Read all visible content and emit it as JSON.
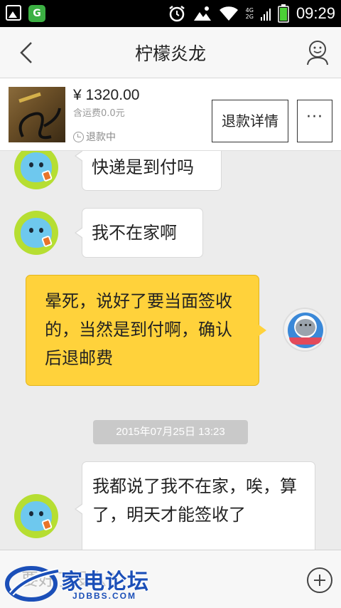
{
  "status_bar": {
    "time": "09:29",
    "network_top": "4G",
    "network_bottom": "2G"
  },
  "header": {
    "title": "柠檬炎龙"
  },
  "product": {
    "price": "¥ 1320.00",
    "shipping": "含运费0.0元",
    "status": "退款中",
    "refund_button": "退款详情",
    "more_button": "···"
  },
  "messages": [
    {
      "side": "left",
      "text": "快递是到付吗"
    },
    {
      "side": "left",
      "text": "我不在家啊"
    },
    {
      "side": "right",
      "text": "晕死，说好了要当面签收的，当然是到付啊，确认后退邮费"
    },
    {
      "side": "left",
      "text": "我都说了我不在家，唉，算了，明天才能签收了"
    }
  ],
  "timestamp": "2015年07月25日 13:23",
  "input": {
    "value": "要好了没么？"
  },
  "watermark": {
    "text": "家电论坛",
    "sub": "JDBBS.COM"
  },
  "colors": {
    "outgoing_bubble": "#ffd23b",
    "incoming_bubble": "#ffffff",
    "background": "#ececec"
  }
}
